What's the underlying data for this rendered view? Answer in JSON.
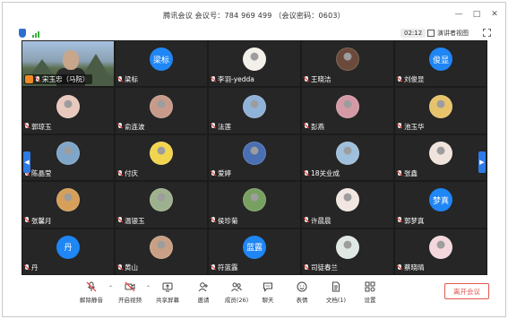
{
  "window": {
    "title": "腾讯会议 会议号：784 969 499 （会议密码：0603）",
    "controls": [
      "—",
      "□",
      "✕"
    ]
  },
  "toolbar": {
    "timer": "02:12",
    "gallery_label": "演讲者视图"
  },
  "participants": [
    {
      "name": "宋玉忠（马院）",
      "type": "video",
      "host": true
    },
    {
      "name": "梁标",
      "type": "text",
      "avatar_text": "梁标",
      "avatar_color": "#1f86f5"
    },
    {
      "name": "李羽-yedda",
      "type": "img",
      "avatar_color": "#f3f0ea"
    },
    {
      "name": "王晓洁",
      "type": "img",
      "avatar_color": "#6b4a3c"
    },
    {
      "name": "刘俊显",
      "type": "text",
      "avatar_text": "俊显",
      "avatar_color": "#1f86f5"
    },
    {
      "name": "郭琼玉",
      "type": "img",
      "avatar_color": "#e9c9bd"
    },
    {
      "name": "俞连波",
      "type": "img",
      "avatar_color": "#c79a8a"
    },
    {
      "name": "法莲",
      "type": "img",
      "avatar_color": "#8fb2d8"
    },
    {
      "name": "彭燕",
      "type": "img",
      "avatar_color": "#d39aa6"
    },
    {
      "name": "池玉华",
      "type": "img",
      "avatar_color": "#e7c36b"
    },
    {
      "name": "陈晶莹",
      "type": "img",
      "avatar_color": "#7fa6c9"
    },
    {
      "name": "付庆",
      "type": "img",
      "avatar_color": "#f2d54f"
    },
    {
      "name": "爱婷",
      "type": "img",
      "avatar_color": "#4a6fb3"
    },
    {
      "name": "18关业成",
      "type": "img",
      "avatar_color": "#9ec0dc"
    },
    {
      "name": "张鑫",
      "type": "img",
      "avatar_color": "#f0e3dc"
    },
    {
      "name": "张馨月",
      "type": "img",
      "avatar_color": "#d6a05a"
    },
    {
      "name": "温银玉",
      "type": "img",
      "avatar_color": "#9eb18e"
    },
    {
      "name": "侯珍菊",
      "type": "img",
      "avatar_color": "#78a060"
    },
    {
      "name": "许晨晨",
      "type": "img",
      "avatar_color": "#f1e6e1"
    },
    {
      "name": "郭梦真",
      "type": "text",
      "avatar_text": "梦真",
      "avatar_color": "#1f86f5"
    },
    {
      "name": "丹",
      "type": "text",
      "avatar_text": "丹",
      "avatar_color": "#1f86f5"
    },
    {
      "name": "黄山",
      "type": "img",
      "avatar_color": "#c9a085"
    },
    {
      "name": "符蓝露",
      "type": "text",
      "avatar_text": "蓝露",
      "avatar_color": "#1f86f5"
    },
    {
      "name": "司徒春兰",
      "type": "img",
      "avatar_color": "#dfe8e2"
    },
    {
      "name": "蔡晓晴",
      "type": "img",
      "avatar_color": "#f3d7dc"
    }
  ],
  "bottom_toolbar": {
    "items": [
      {
        "label": "解除静音",
        "icon": "mic-muted-icon"
      },
      {
        "label": "开启视频",
        "icon": "video-off-icon"
      },
      {
        "label": "共享屏幕",
        "icon": "share-screen-icon"
      },
      {
        "label": "邀请",
        "icon": "invite-icon"
      },
      {
        "label": "成员(26)",
        "icon": "members-icon"
      },
      {
        "label": "聊天",
        "icon": "chat-icon"
      },
      {
        "label": "表情",
        "icon": "emoji-icon"
      },
      {
        "label": "文档(1)",
        "icon": "document-icon"
      },
      {
        "label": "设置",
        "icon": "settings-icon"
      }
    ],
    "leave_label": "离开会议"
  }
}
